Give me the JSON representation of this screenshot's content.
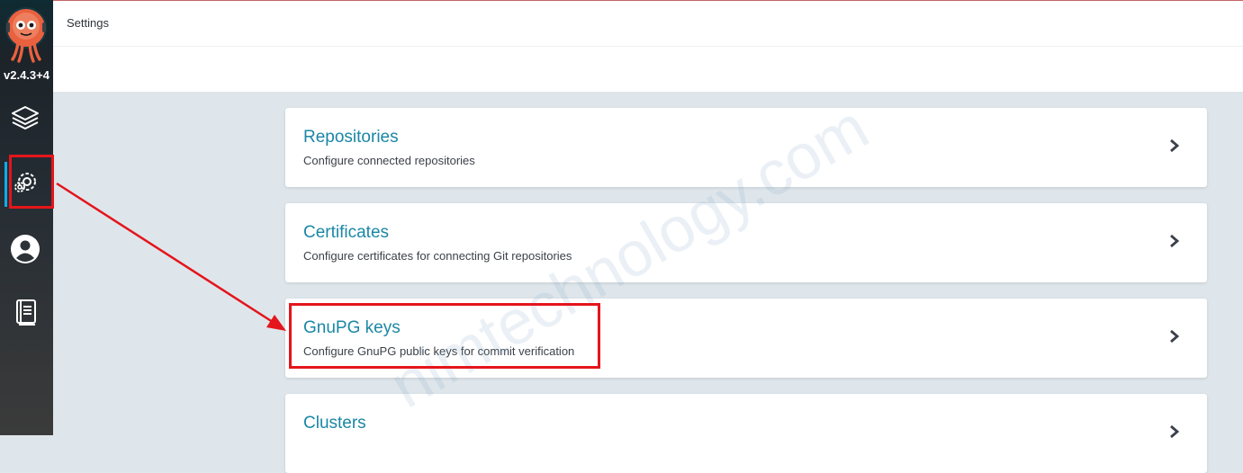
{
  "sidebar": {
    "version": "v2.4.3+4",
    "items": [
      {
        "icon": "layers-icon"
      },
      {
        "icon": "gear-icon",
        "active": true
      },
      {
        "icon": "user-icon"
      },
      {
        "icon": "docs-icon"
      }
    ]
  },
  "header": {
    "title": "Settings"
  },
  "cards": [
    {
      "title": "Repositories",
      "description": "Configure connected repositories"
    },
    {
      "title": "Certificates",
      "description": "Configure certificates for connecting Git repositories"
    },
    {
      "title": "GnuPG keys",
      "description": "Configure GnuPG public keys for commit verification"
    },
    {
      "title": "Clusters",
      "description": ""
    }
  ],
  "watermark": "nimtechnology.com",
  "colors": {
    "accent": "#1b87a6",
    "active_indicator": "#0dadea",
    "highlight": "#e4151b",
    "background": "#dee6eb"
  }
}
